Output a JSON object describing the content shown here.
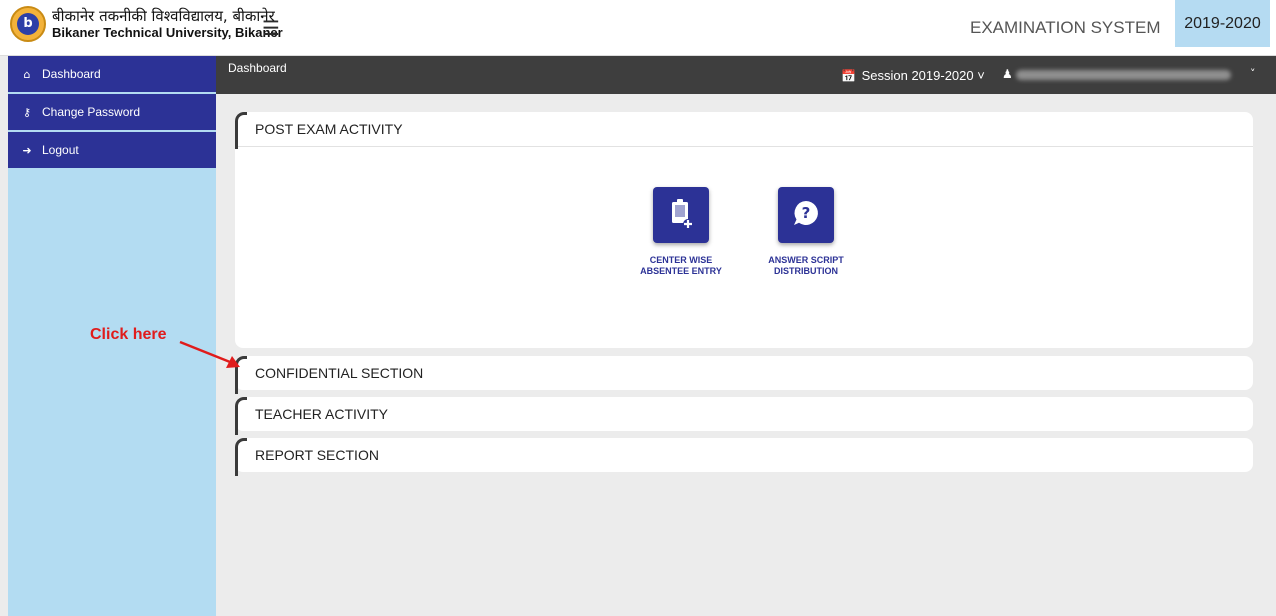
{
  "header": {
    "logo_letter": "b",
    "university_hindi": "बीकानेर तकनीकी विश्वविद्यालय, बीकानेर",
    "university_english": "Bikaner Technical University, Bikaner",
    "system_title": "EXAMINATION SYSTEM",
    "year": "2019-2020",
    "menu_icon": "hamburger-icon"
  },
  "sidebar": {
    "items": [
      {
        "label": "Dashboard",
        "icon": "home-icon"
      },
      {
        "label": "Change Password",
        "icon": "key-icon"
      },
      {
        "label": "Logout",
        "icon": "logout-icon"
      }
    ]
  },
  "topnav": {
    "breadcrumb": "Dashboard",
    "session_label": "Session",
    "session_value": "2019-2020"
  },
  "panels": [
    {
      "title": "POST EXAM ACTIVITY"
    },
    {
      "title": "CONFIDENTIAL SECTION"
    },
    {
      "title": "TEACHER ACTIVITY"
    },
    {
      "title": "REPORT SECTION"
    }
  ],
  "tiles": [
    {
      "line1": "CENTER WISE",
      "line2": "ABSENTEE ENTRY",
      "icon": "clipboard-add-icon"
    },
    {
      "line1": "ANSWER SCRIPT",
      "line2": "DISTRIBUTION",
      "icon": "question-bubble-icon"
    }
  ],
  "annotation": {
    "text": "Click here",
    "color": "#e01c1c"
  },
  "colors": {
    "primary": "#2c3296",
    "sidebar_bg": "#b3dcf2",
    "topbar_dark": "#3e3e3e",
    "year_badge": "#b5dbf2"
  }
}
